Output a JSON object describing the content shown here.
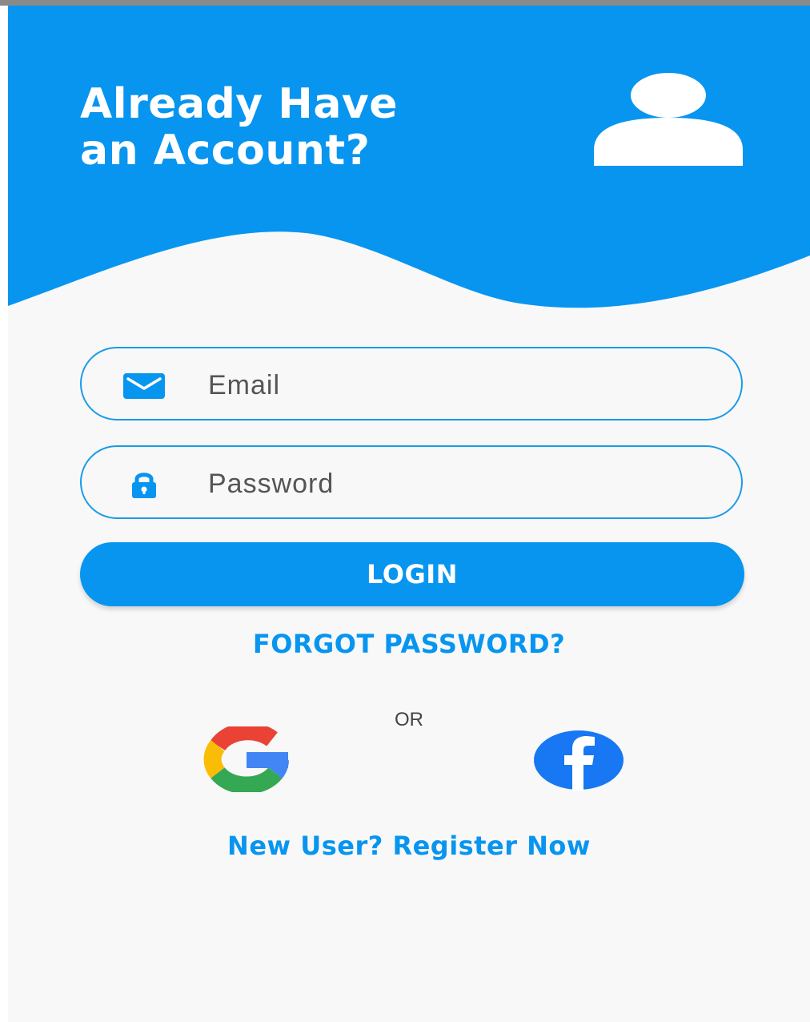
{
  "colors": {
    "brand_blue": "#0795f0",
    "field_border": "#1a9be8",
    "screen_background": "#f8f8f8",
    "white": "#ffffff"
  },
  "header": {
    "title_line1": "Already Have",
    "title_line2": "an Account?",
    "icon": "user-icon"
  },
  "form": {
    "email": {
      "icon": "mail-icon",
      "value": "",
      "placeholder": "Email"
    },
    "password": {
      "icon": "lock-icon",
      "value": "",
      "placeholder": "Password"
    },
    "login_label": "LOGIN",
    "forgot_label": "FORGOT PASSWORD?"
  },
  "social": {
    "separator": "OR",
    "providers": [
      {
        "name": "Google",
        "icon": "google-icon"
      },
      {
        "name": "Facebook",
        "icon": "facebook-icon"
      }
    ]
  },
  "footer": {
    "register_label": "New User? Register Now"
  }
}
